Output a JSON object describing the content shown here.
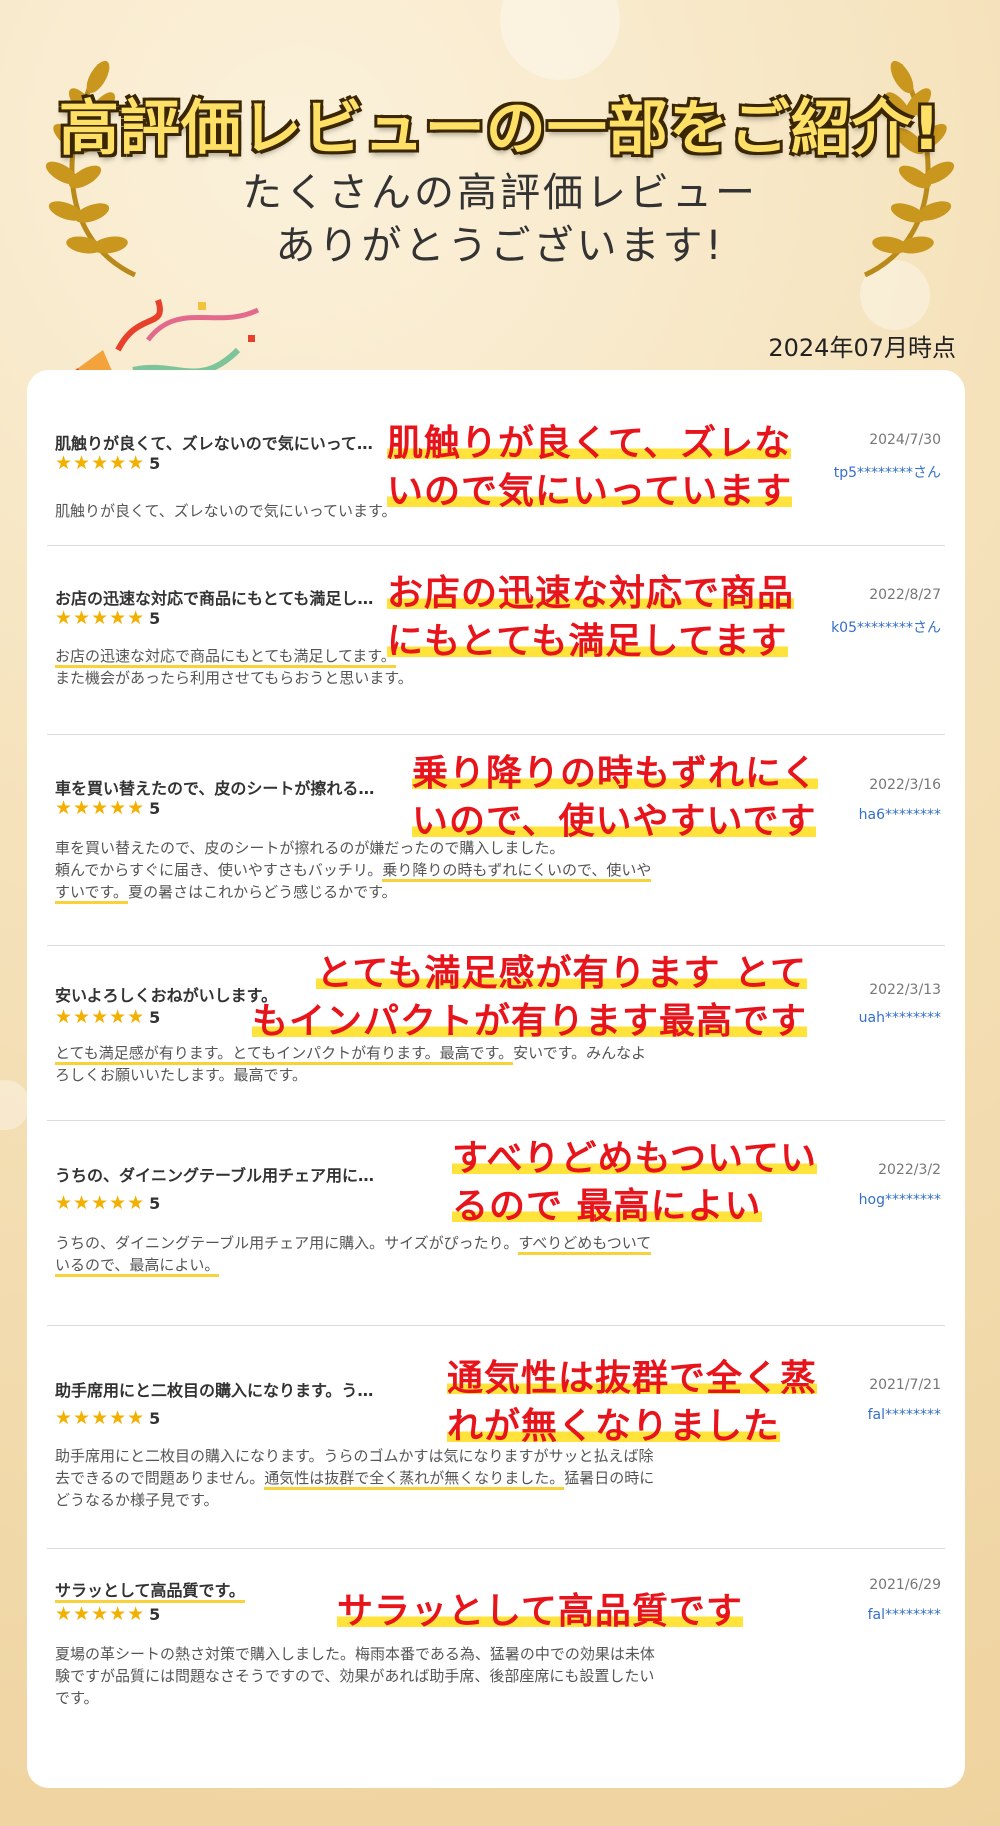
{
  "header": {
    "headline": "高評価レビューの一部をご紹介!",
    "sub_line1": "たくさんの高評価レビュー",
    "sub_line2": "ありがとうございます!",
    "as_of": "2024年07月時点"
  },
  "colors": {
    "star": "#f2b000",
    "callout": "#e8141b",
    "highlight": "#ffe33a",
    "user": "#3570c8"
  },
  "icons": {
    "laurel": "laurel-wreath-icon",
    "popper": "party-popper-icon",
    "star": "star-icon"
  },
  "reviews": [
    {
      "title": "肌触りが良くて、ズレないので気にいって…",
      "stars": "★★★★★",
      "rating": "5",
      "date": "2024/7/30",
      "user": "tp5********さん",
      "body": "肌触りが良くて、ズレないので気にいっています。",
      "callout1": "肌触りが良くて、ズレな",
      "callout2": "いので気にいっています"
    },
    {
      "title": "お店の迅速な対応で商品にもとても満足し…",
      "stars": "★★★★★",
      "rating": "5",
      "date": "2022/8/27",
      "user": "k05********さん",
      "body1": "お店の迅速な対応で商品にもとても満足してます。",
      "body2": "また機会があったら利用させてもらおうと思います。",
      "callout1": "お店の迅速な対応で商品",
      "callout2": "にもとても満足してます"
    },
    {
      "title": "車を買い替えたので、皮のシートが擦れる…",
      "stars": "★★★★★",
      "rating": "5",
      "date": "2022/3/16",
      "user": "ha6********",
      "body1": "車を買い替えたので、皮のシートが擦れるのが嫌だったので購入しました。",
      "body2a": "頼んでからすぐに届き、使いやすさもバッチリ。",
      "body2b": "乗り降りの時もずれにくいので、使いや",
      "body3a": "すいです。",
      "body3b": "夏の暑さはこれからどう感じるかです。",
      "callout1": "乗り降りの時もずれにく",
      "callout2": "いので、使いやすいです"
    },
    {
      "title": "安いよろしくおねがいします。",
      "stars": "★★★★★",
      "rating": "5",
      "date": "2022/3/13",
      "user": "uah********",
      "body1a": "とても満足感が有ります。とてもインパクトが有ります。最高です。",
      "body1b": "安いです。みんなよ",
      "body2": "ろしくお願いいたします。最高です。",
      "callout1": "とても満足感が有ります とて",
      "callout2": "もインパクトが有ります最高です"
    },
    {
      "title": "うちの、ダイニングテーブル用チェア用に…",
      "stars": "★★★★★",
      "rating": "5",
      "date": "2022/3/2",
      "user": "hog********",
      "body1a": "うちの、ダイニングテーブル用チェア用に購入。サイズがぴったり。",
      "body1b": "すべりどめもついて",
      "body2": "いるので、最高によい。",
      "callout1": "すべりどめもついてい",
      "callout2": "るので 最高によい"
    },
    {
      "title": "助手席用にと二枚目の購入になります。う…",
      "stars": "★★★★★",
      "rating": "5",
      "date": "2021/7/21",
      "user": "fal********",
      "body1": "助手席用にと二枚目の購入になります。うらのゴムかすは気になりますがサッと払えば除",
      "body2a": "去できるので問題ありません。",
      "body2b": "通気性は抜群で全く蒸れが無くなりました。",
      "body2c": "猛暑日の時に",
      "body3": "どうなるか様子見です。",
      "callout1": "通気性は抜群で全く蒸",
      "callout2": "れが無くなりました"
    },
    {
      "title": "サラッとして高品質です。",
      "stars": "★★★★★",
      "rating": "5",
      "date": "2021/6/29",
      "user": "fal********",
      "body1": "夏場の革シートの熱さ対策で購入しました。梅雨本番である為、猛暑の中での効果は未体",
      "body2": "験ですが品質には問題なさそうですので、効果があれば助手席、後部座席にも設置したい",
      "body3": "です。",
      "callout1": "サラッとして高品質です"
    }
  ]
}
